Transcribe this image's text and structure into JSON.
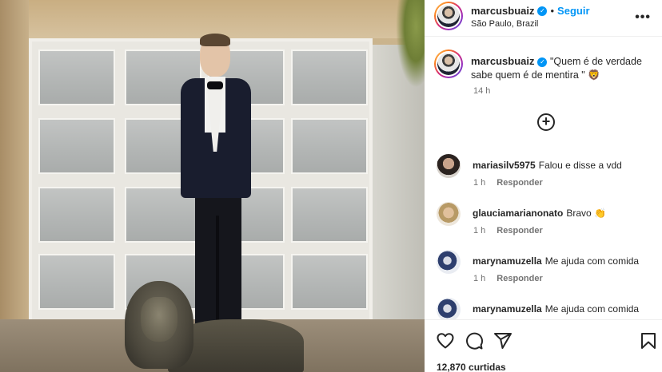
{
  "post": {
    "username": "marcusbuaiz",
    "follow_label": "Seguir",
    "separator": "•",
    "location": "São Paulo, Brazil",
    "more_label": "•••",
    "caption": "\"Quem é de verdade sabe quem é de mentira \" 🦁",
    "caption_time": "14 h",
    "load_more_label": "+"
  },
  "comments": [
    {
      "username": "mariasilv5975",
      "text": "Falou e disse a vdd",
      "time": "1 h",
      "reply": "Responder"
    },
    {
      "username": "glauciamarianonato",
      "text": "Bravo 👏",
      "time": "1 h",
      "reply": "Responder"
    },
    {
      "username": "marynamuzella",
      "text": "Me ajuda com comida",
      "time": "1 h",
      "reply": "Responder"
    },
    {
      "username": "marynamuzella",
      "text": "Me ajuda com comida",
      "time": "",
      "reply": ""
    }
  ],
  "actions": {
    "likes_text": "12,870 curtidas",
    "icons": [
      "heart-icon",
      "comment-icon",
      "share-icon",
      "bookmark-icon"
    ]
  },
  "colors": {
    "accent": "#0095f6",
    "text": "#262626",
    "muted": "#737373"
  }
}
